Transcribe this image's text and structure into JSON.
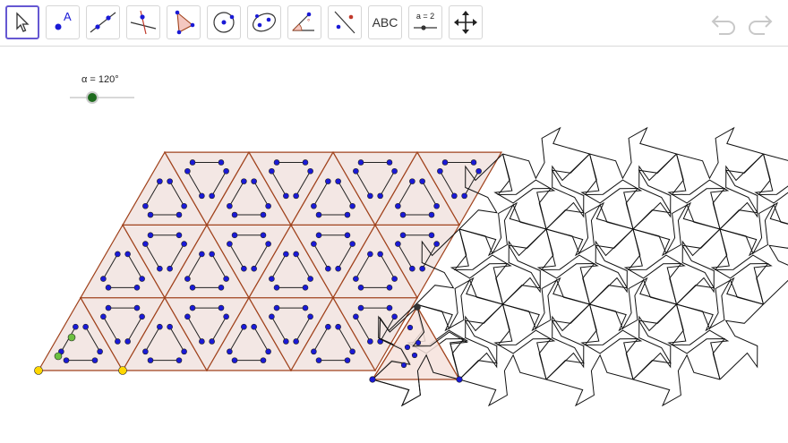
{
  "toolbar": {
    "tools": [
      {
        "id": "move",
        "icon": "move-arrow-icon",
        "active": true
      },
      {
        "id": "point",
        "icon": "point-icon",
        "label": "A"
      },
      {
        "id": "line",
        "icon": "line-through-two-points-icon"
      },
      {
        "id": "perpendicular",
        "icon": "perpendicular-line-icon"
      },
      {
        "id": "polygon",
        "icon": "polygon-icon"
      },
      {
        "id": "circle",
        "icon": "circle-center-point-icon"
      },
      {
        "id": "ellipse",
        "icon": "ellipse-icon"
      },
      {
        "id": "angle",
        "icon": "angle-icon"
      },
      {
        "id": "reflect",
        "icon": "reflect-about-line-icon"
      },
      {
        "id": "text",
        "icon": "text-icon",
        "label": "ABC"
      },
      {
        "id": "slider",
        "icon": "slider-icon",
        "label": "a = 2"
      },
      {
        "id": "move-view",
        "icon": "move-graphics-view-icon"
      }
    ],
    "undo_icon": "undo-icon",
    "redo_icon": "redo-icon"
  },
  "slider": {
    "label": "α = 120°",
    "value_deg": 120,
    "knob_color": "#1e6b1e"
  },
  "colors": {
    "tile_fill": "#f3e7e4",
    "tile_stroke": "#a0421c",
    "point_blue": "#1a1ad6",
    "point_yellow": "#ffd700",
    "point_green": "#6cc040",
    "tessellation_stroke": "#111111",
    "active_tool_border": "#6557d2"
  },
  "lattice": {
    "rows": 3,
    "cols": 4
  }
}
